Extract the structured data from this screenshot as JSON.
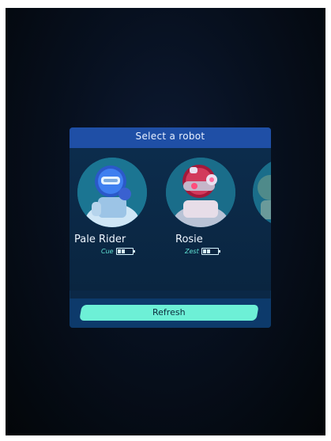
{
  "dialog": {
    "title": "Select a robot"
  },
  "robots": [
    {
      "name": "Pale Rider",
      "trait": "Cue",
      "portrait_icon": "pale-rider-robot-icon",
      "battery_level": 0.66
    },
    {
      "name": "Rosie",
      "trait": "Zest",
      "portrait_icon": "rosie-robot-icon",
      "battery_level": 0.66
    },
    {
      "name": "",
      "trait": "",
      "portrait_icon": "partial-robot-icon"
    }
  ],
  "footer": {
    "refresh_label": "Refresh"
  },
  "colors": {
    "header": "#1f4fa6",
    "panel": "#0b2846",
    "accent": "#6df0d6",
    "trait_text": "#5fe0d2",
    "portrait_bg": "#1a6d8a"
  }
}
